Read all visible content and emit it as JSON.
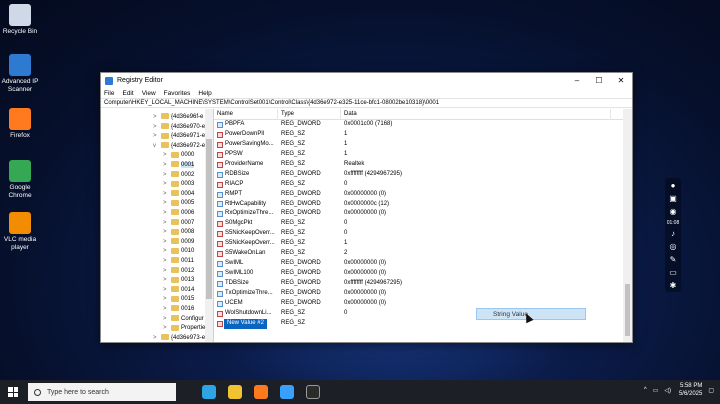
{
  "desktop": {
    "icons": [
      {
        "label": "Recycle Bin",
        "icon": "recycle-bin-icon",
        "color": "#cfd8e6"
      },
      {
        "label": "Advanced IP Scanner",
        "icon": "advanced-ip-scanner-icon",
        "color": "#2f7ad1"
      },
      {
        "label": "Firefox",
        "icon": "firefox-icon",
        "color": "#ff7a1f"
      },
      {
        "label": "Google Chrome",
        "icon": "chrome-icon",
        "color": "#34a853"
      },
      {
        "label": "VLC media player",
        "icon": "vlc-icon",
        "color": "#f28c00"
      }
    ]
  },
  "side_toolbar": {
    "clock": "01:08"
  },
  "window": {
    "title": "Registry Editor",
    "menu": [
      "File",
      "Edit",
      "View",
      "Favorites",
      "Help"
    ],
    "address": "Computer\\HKEY_LOCAL_MACHINE\\SYSTEM\\ControlSet001\\Control\\Class\\{4d36e972-e325-11ce-bfc1-08002be10318}\\0001",
    "tree": [
      {
        "label": "{4d36e96f-e",
        "indent": 0,
        "chevron": ">"
      },
      {
        "label": "{4d36e970-e",
        "indent": 0,
        "chevron": ">"
      },
      {
        "label": "{4d36e971-e",
        "indent": 0,
        "chevron": ">"
      },
      {
        "label": "{4d36e972-e",
        "indent": 0,
        "chevron": "v"
      },
      {
        "label": "0000",
        "indent": 1,
        "chevron": ">"
      },
      {
        "label": "0001",
        "indent": 1,
        "chevron": ">",
        "selected": true
      },
      {
        "label": "0002",
        "indent": 1,
        "chevron": ">"
      },
      {
        "label": "0003",
        "indent": 1,
        "chevron": ">"
      },
      {
        "label": "0004",
        "indent": 1,
        "chevron": ">"
      },
      {
        "label": "0005",
        "indent": 1,
        "chevron": ">"
      },
      {
        "label": "0006",
        "indent": 1,
        "chevron": ">"
      },
      {
        "label": "0007",
        "indent": 1,
        "chevron": ">"
      },
      {
        "label": "0008",
        "indent": 1,
        "chevron": ">"
      },
      {
        "label": "0009",
        "indent": 1,
        "chevron": ">"
      },
      {
        "label": "0010",
        "indent": 1,
        "chevron": ">"
      },
      {
        "label": "0011",
        "indent": 1,
        "chevron": ">"
      },
      {
        "label": "0012",
        "indent": 1,
        "chevron": ">"
      },
      {
        "label": "0013",
        "indent": 1,
        "chevron": ">"
      },
      {
        "label": "0014",
        "indent": 1,
        "chevron": ">"
      },
      {
        "label": "0015",
        "indent": 1,
        "chevron": ">"
      },
      {
        "label": "0016",
        "indent": 1,
        "chevron": ">"
      },
      {
        "label": "Configur",
        "indent": 1,
        "chevron": ">"
      },
      {
        "label": "Propertie",
        "indent": 1,
        "chevron": ">"
      },
      {
        "label": "{4d36e973-e",
        "indent": 0,
        "chevron": ">"
      }
    ],
    "columns": [
      "Name",
      "Type",
      "Data"
    ],
    "values": [
      {
        "name": "PBPFA",
        "type": "REG_DWORD",
        "data": "0x0001c00 (7168)"
      },
      {
        "name": "PowerDownPll",
        "type": "REG_SZ",
        "data": "1"
      },
      {
        "name": "PowerSavingMo...",
        "type": "REG_SZ",
        "data": "1"
      },
      {
        "name": "PPSW",
        "type": "REG_SZ",
        "data": "1"
      },
      {
        "name": "ProviderName",
        "type": "REG_SZ",
        "data": "Realtek"
      },
      {
        "name": "RDBSize",
        "type": "REG_DWORD",
        "data": "0xffffffff (4294967295)"
      },
      {
        "name": "RIACP",
        "type": "REG_SZ",
        "data": "0"
      },
      {
        "name": "RMPT",
        "type": "REG_DWORD",
        "data": "0x00000000 (0)"
      },
      {
        "name": "RtHwCapability",
        "type": "REG_DWORD",
        "data": "0x0000000c (12)"
      },
      {
        "name": "RxOptimizeThre...",
        "type": "REG_DWORD",
        "data": "0x00000000 (0)"
      },
      {
        "name": "S0MgcPkt",
        "type": "REG_SZ",
        "data": "0"
      },
      {
        "name": "S5NicKeepOverr...",
        "type": "REG_SZ",
        "data": "0"
      },
      {
        "name": "S5NicKeepOverr...",
        "type": "REG_SZ",
        "data": "1"
      },
      {
        "name": "S5WakeOnLan",
        "type": "REG_SZ",
        "data": "2"
      },
      {
        "name": "SwIML",
        "type": "REG_DWORD",
        "data": "0x00000000 (0)"
      },
      {
        "name": "SwIML100",
        "type": "REG_DWORD",
        "data": "0x00000000 (0)"
      },
      {
        "name": "TDBSize",
        "type": "REG_DWORD",
        "data": "0xffffffff (4294967295)"
      },
      {
        "name": "TxOptimizeThre...",
        "type": "REG_DWORD",
        "data": "0x00000000 (0)"
      },
      {
        "name": "UCEM",
        "type": "REG_DWORD",
        "data": "0x00000000 (0)"
      },
      {
        "name": "WolShutdownLi...",
        "type": "REG_SZ",
        "data": "0"
      },
      {
        "name": "New Value #2",
        "type": "REG_SZ",
        "data": "",
        "editing": true
      }
    ]
  },
  "context_menu": {
    "item": "String Value"
  },
  "taskbar": {
    "search_placeholder": "Type here to search",
    "apps": [
      {
        "icon": "edge-icon",
        "color": "#2ea4e5"
      },
      {
        "icon": "file-explorer-icon",
        "color": "#f1c232"
      },
      {
        "icon": "firefox-taskbar-icon",
        "color": "#ff7a1f"
      },
      {
        "icon": "regedit-taskbar-icon",
        "color": "#3aa0ff"
      },
      {
        "icon": "terminal-icon",
        "color": "#2b2b2b"
      }
    ],
    "time": "5:58 PM",
    "date": "5/6/2025"
  }
}
